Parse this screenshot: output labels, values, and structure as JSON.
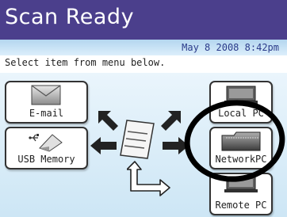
{
  "header": {
    "title": "Scan Ready"
  },
  "status": {
    "date": "May  8 2008",
    "time": "8:42pm"
  },
  "instruction": "Select item from menu below.",
  "menu": {
    "email_label": "E-mail",
    "usb_label": "USB Memory",
    "local_pc_label": "Local PC",
    "network_pc_label": "NetworkPC",
    "remote_pc_label": "Remote PC"
  },
  "icons": {
    "email": "envelope-icon",
    "usb": "usb-memory-icon",
    "local_pc": "computer-icon",
    "network_pc": "network-folder-icon",
    "remote_pc": "remote-pc-icon",
    "center": "document-icon"
  },
  "colors": {
    "title_bar": "#4b3f8c",
    "info_strip": "#b4d6ef",
    "panel": "#dceefb",
    "annotation": "#000000"
  }
}
